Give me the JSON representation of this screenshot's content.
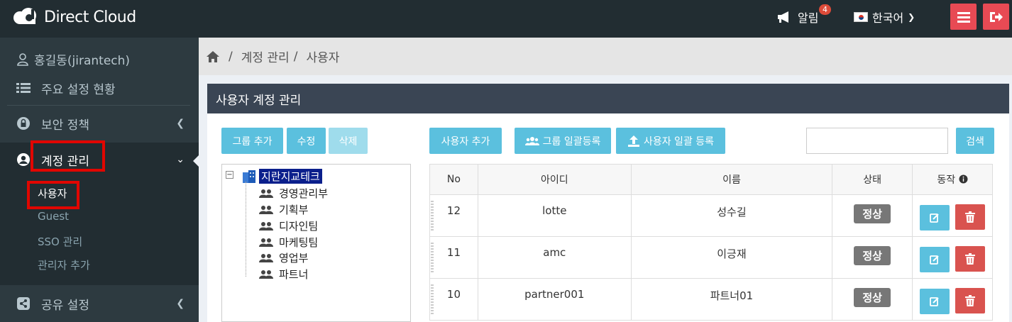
{
  "app": {
    "brand": "Direct Cloud"
  },
  "topbar": {
    "notifications_label": "알림",
    "notifications_count": "4",
    "language_label": "한국어"
  },
  "sidebar": {
    "user": "홍길동(jirantech)",
    "items": [
      {
        "label": "주요 설정 현황"
      },
      {
        "label": "보안 정책"
      },
      {
        "label": "계정 관리"
      },
      {
        "label": "공유 설정"
      }
    ],
    "submenu": [
      {
        "label": "사용자"
      },
      {
        "label": "Guest"
      },
      {
        "label": "SSO 관리"
      },
      {
        "label": "관리자 추가"
      }
    ]
  },
  "breadcrumb": {
    "items": [
      "계정 관리",
      "사용자"
    ],
    "separator": "/"
  },
  "panel": {
    "title": "사용자 계정 관리",
    "buttons": {
      "add_group": "그룹 추가",
      "edit": "수정",
      "delete": "삭제",
      "add_user": "사용자 추가",
      "bulk_group": "그룹 일괄등록",
      "bulk_user": "사용자 일괄 등록",
      "search": "검색"
    },
    "search": {
      "value": ""
    }
  },
  "tree": {
    "root": "지란지교테크",
    "children": [
      "경영관리부",
      "기획부",
      "디자인팀",
      "마케팅팀",
      "영업부",
      "파트너"
    ]
  },
  "table": {
    "headers": {
      "no": "No",
      "id": "아이디",
      "name": "이름",
      "status": "상태",
      "action": "동작"
    },
    "rows": [
      {
        "no": "12",
        "id": "lotte",
        "name": "성수길",
        "status": "정상"
      },
      {
        "no": "11",
        "id": "amc",
        "name": "이긍재",
        "status": "정상"
      },
      {
        "no": "10",
        "id": "partner001",
        "name": "파트너01",
        "status": "정상"
      }
    ]
  },
  "colors": {
    "accent": "#5bc0de",
    "danger": "#d9534f",
    "highlight": "#e10600",
    "topbar": "#222d32"
  }
}
